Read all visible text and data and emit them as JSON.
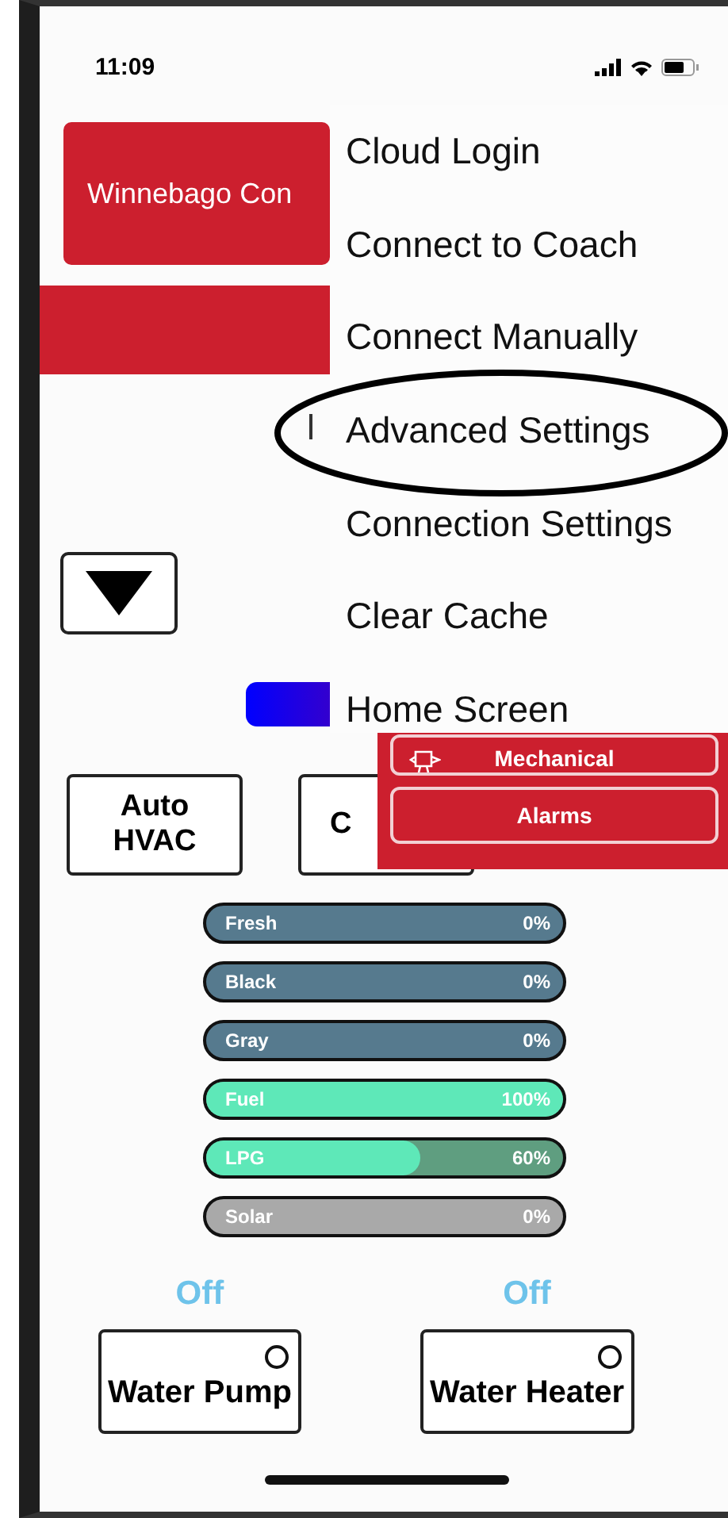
{
  "status_bar": {
    "time": "11:09"
  },
  "header": {
    "title": "Winnebago Con"
  },
  "menu": {
    "items": [
      {
        "label": "Cloud Login",
        "circled": false
      },
      {
        "label": "Connect to Coach",
        "circled": false
      },
      {
        "label": "Connect Manually",
        "circled": false
      },
      {
        "label": "Advanced Settings",
        "circled": true
      },
      {
        "label": "Connection Settings",
        "circled": false
      },
      {
        "label": "Clear Cache",
        "circled": false
      },
      {
        "label": "Home Screen",
        "circled": false
      }
    ]
  },
  "mode_buttons": [
    {
      "label": "Auto HVAC"
    },
    {
      "label": "C"
    }
  ],
  "panel": {
    "buttons": [
      {
        "label": "Mechanical",
        "kind": "icon"
      },
      {
        "label": "Alarms",
        "kind": "plain"
      }
    ]
  },
  "tanks": [
    {
      "name": "Fresh",
      "reading": "0%",
      "level": 0,
      "kind": "water"
    },
    {
      "name": "Black",
      "reading": "0%",
      "level": 0,
      "kind": "water"
    },
    {
      "name": "Gray",
      "reading": "0%",
      "level": 0,
      "kind": "water"
    },
    {
      "name": "Fuel",
      "reading": "100%",
      "level": 1,
      "kind": "fuel"
    },
    {
      "name": "LPG",
      "reading": "60%",
      "level": 0.6,
      "kind": "fuel"
    },
    {
      "name": "Solar",
      "reading": "0%",
      "level": 0,
      "kind": "solar"
    }
  ],
  "switches": [
    {
      "status": "Off",
      "label": "Water Pump",
      "on": false
    },
    {
      "status": "Off",
      "label": "Water Heater",
      "on": false
    }
  ]
}
